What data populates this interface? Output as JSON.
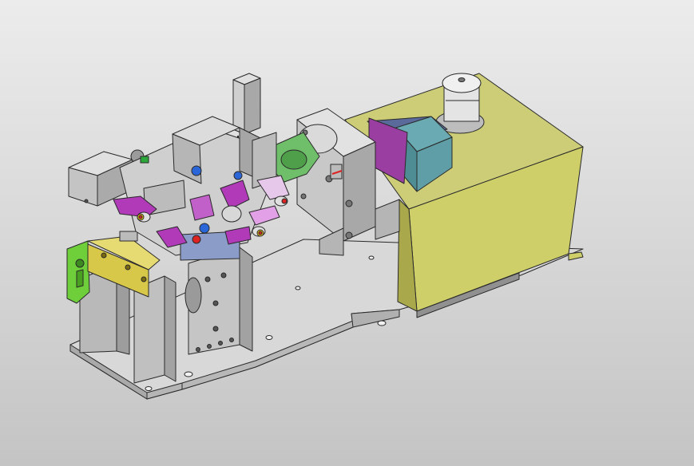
{
  "scene": {
    "background_top": "#ececec",
    "background_bottom": "#c4c4c4",
    "plate_color": "#d8d8d8",
    "metal_color": "#c9c9c9",
    "housing_color": "#cfcf6a",
    "motor_color": "#5f9ea6",
    "clamp_color": "#b03ab8",
    "bracket_color": "#6fcf3a",
    "fixture_color": "#d8c84a",
    "flange_color": "#6fbf6a",
    "edge_color": "#2a2a2a"
  }
}
